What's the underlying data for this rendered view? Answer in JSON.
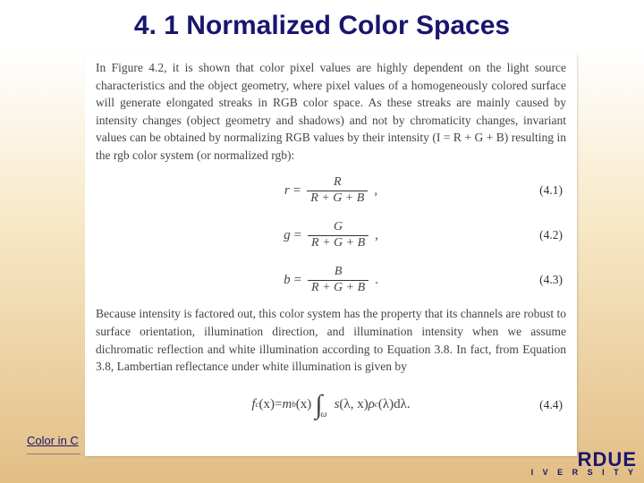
{
  "title": "4. 1 Normalized Color Spaces",
  "para1": "In Figure 4.2, it is shown that color pixel values are highly dependent on the light source characteristics and the object geometry, where pixel values of a homogeneously colored surface will generate elongated streaks in RGB color space. As these streaks are mainly caused by intensity changes (object geometry and shadows) and not by chromaticity changes, invariant values can be obtained by normalizing RGB values by their intensity (I = R + G + B) resulting in the rgb color system (or normalized rgb):",
  "eq1": {
    "lhs": "r",
    "num": "R",
    "den": "R + G + B",
    "punct": ",",
    "tag": "(4.1)"
  },
  "eq2": {
    "lhs": "g",
    "num": "G",
    "den": "R + G + B",
    "punct": ",",
    "tag": "(4.2)"
  },
  "eq3": {
    "lhs": "b",
    "num": "B",
    "den": "R + G + B",
    "punct": ".",
    "tag": "(4.3)"
  },
  "para2": "Because intensity is factored out, this color system has the property that its channels are robust to surface orientation, illumination direction, and illumination intensity when we assume dichromatic reflection and white illumination according to Equation 3.8. In fact, from Equation 3.8, Lambertian reflectance under white illumination is given by",
  "eq4": {
    "lhs_f": "f",
    "lhs_sup": "c",
    "lhs_arg": "(x)",
    "eq": " = ",
    "m": "m",
    "m_sup": "b",
    "m_arg": "(x)",
    "int_sub": "ω",
    "integrand_s": "s",
    "integrand_s_args": "(λ, x)",
    "integrand_rho": "ρ",
    "integrand_rho_sup": "c",
    "integrand_rho_args": "(λ)",
    "dlambda": " dλ.",
    "tag": "(4.4)"
  },
  "footer_link": "Color in C",
  "brand_main": "RDUE",
  "brand_sub": "I V E R S I T Y"
}
